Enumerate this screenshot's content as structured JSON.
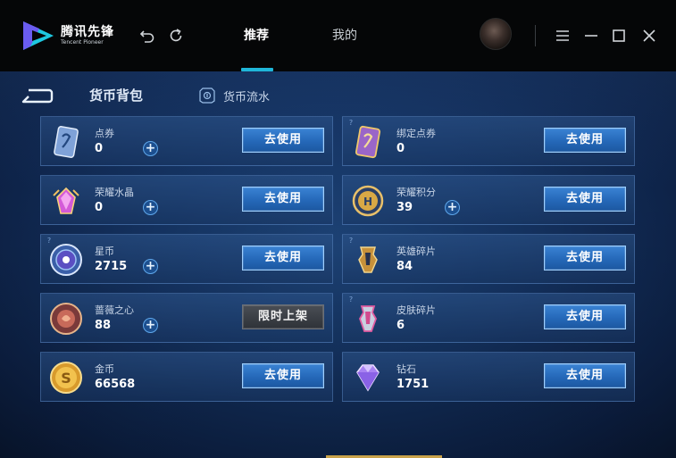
{
  "app": {
    "logo_cn": "腾讯先锋",
    "logo_en": "Tencent Pioneer"
  },
  "tabs": [
    {
      "label": "推荐",
      "active": true
    },
    {
      "label": "我的",
      "active": false
    }
  ],
  "panel": {
    "title": "货币背包",
    "flow_link": "货币流水"
  },
  "cards": [
    {
      "name": "点券",
      "amount": "0",
      "action": "去使用",
      "has_plus": true,
      "has_help": false,
      "disabled": false
    },
    {
      "name": "绑定点券",
      "amount": "0",
      "action": "去使用",
      "has_plus": false,
      "has_help": true,
      "disabled": false
    },
    {
      "name": "荣耀水晶",
      "amount": "0",
      "action": "去使用",
      "has_plus": true,
      "has_help": false,
      "disabled": false
    },
    {
      "name": "荣耀积分",
      "amount": "39",
      "action": "去使用",
      "has_plus": true,
      "has_help": false,
      "disabled": false
    },
    {
      "name": "星币",
      "amount": "2715",
      "action": "去使用",
      "has_plus": true,
      "has_help": true,
      "disabled": false
    },
    {
      "name": "英雄碎片",
      "amount": "84",
      "action": "去使用",
      "has_plus": false,
      "has_help": true,
      "disabled": false
    },
    {
      "name": "蔷薇之心",
      "amount": "88",
      "action": "限时上架",
      "has_plus": true,
      "has_help": false,
      "disabled": true
    },
    {
      "name": "皮肤碎片",
      "amount": "6",
      "action": "去使用",
      "has_plus": false,
      "has_help": true,
      "disabled": false
    },
    {
      "name": "金币",
      "amount": "66568",
      "action": "去使用",
      "has_plus": false,
      "has_help": false,
      "disabled": false
    },
    {
      "name": "钻石",
      "amount": "1751",
      "action": "去使用",
      "has_plus": false,
      "has_help": false,
      "disabled": false
    }
  ],
  "colors": {
    "accent": "#1fb6d9",
    "button": "#2a70c4",
    "panel_bg": "#143260"
  }
}
